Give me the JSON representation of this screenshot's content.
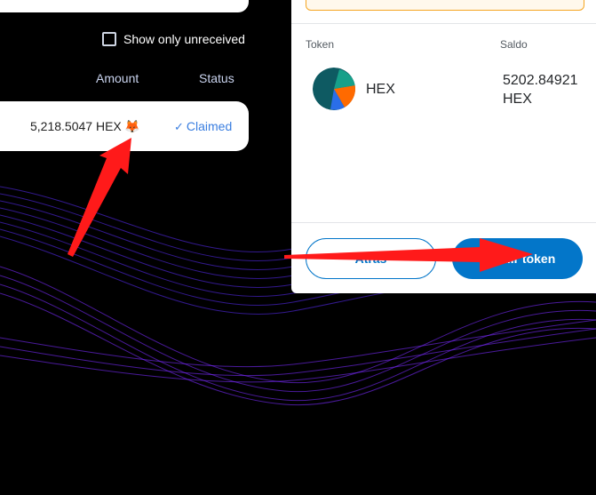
{
  "claim": {
    "show_unreceived_label": "Show only unreceived",
    "columns": {
      "amount": "Amount",
      "status": "Status"
    },
    "row": {
      "amount": "5,218.5047 HEX",
      "fox_icon": "metamask-fox-icon",
      "status_check": "✓",
      "status": "Claimed"
    }
  },
  "wallet": {
    "headers": {
      "token": "Token",
      "balance": "Saldo"
    },
    "token": {
      "symbol": "HEX",
      "balance_line1": "5202.84921",
      "balance_line2": "HEX"
    },
    "buttons": {
      "back": "Atrás",
      "add": "Añadir token"
    }
  },
  "colors": {
    "accent": "#0376c9",
    "claimed": "#3a7ee0",
    "arrow": "#ff1a1a"
  }
}
